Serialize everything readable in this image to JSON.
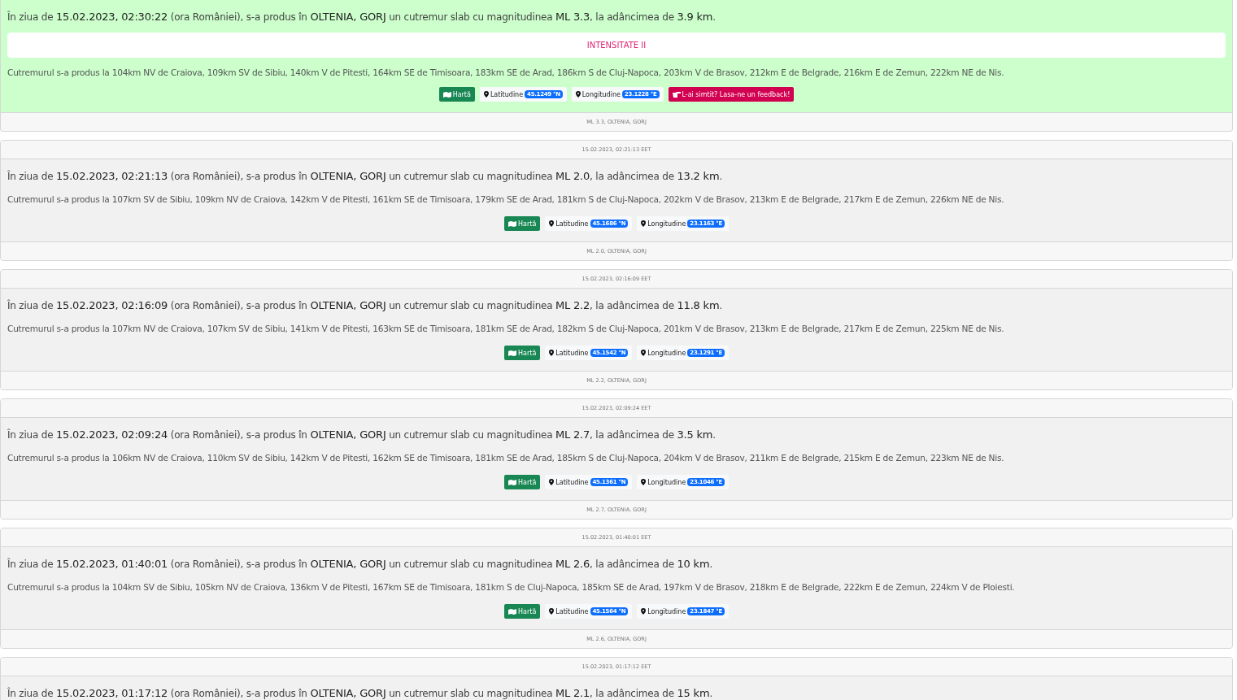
{
  "events": [
    {
      "highlighted": true,
      "sentence": "În ziua de **15.02.2023, 02:30:22** (ora României), s-a produs în **OLTENIA, GORJ** un cutremur slab cu magnitudinea **ML 3.3**, la adâncimea de **3.9 km**.",
      "intensity": "INTENSITATE II",
      "distances": "Cutremurul s-a produs la 104km NV de Craiova, 109km SV de Sibiu, 140km V de Pitesti, 164km SE de Timisoara, 183km SE de Arad, 186km S de Cluj-Napoca, 203km V de Brasov, 212km E de Belgrade, 216km E de Zemun, 222km NE de Nis.",
      "map": "Hartă",
      "lat_label": "Latitudine",
      "lat": "45.1249 °N",
      "lon_label": "Longitudine",
      "lon": "23.1228 °E",
      "feedback": "L-ai simtit? Lasa-ne un feedback!",
      "footer": "ML 3.3, OLTENIA, GORJ"
    },
    {
      "highlighted": false,
      "header": "15.02.2023, 02:21:13 EET",
      "sentence": "În ziua de **15.02.2023, 02:21:13** (ora României), s-a produs în **OLTENIA, GORJ** un cutremur slab cu magnitudinea **ML 2.0**, la adâncimea de **13.2 km**.",
      "distances": "Cutremurul s-a produs la 107km SV de Sibiu, 109km NV de Craiova, 142km V de Pitesti, 161km SE de Timisoara, 179km SE de Arad, 181km S de Cluj-Napoca, 202km V de Brasov, 213km E de Belgrade, 217km E de Zemun, 226km NE de Nis.",
      "map": "Hartă",
      "lat_label": "Latitudine",
      "lat": "45.1686 °N",
      "lon_label": "Longitudine",
      "lon": "23.1163 °E",
      "footer": "ML 2.0, OLTENIA, GORJ"
    },
    {
      "highlighted": false,
      "header": "15.02.2023, 02:16:09 EET",
      "sentence": "În ziua de **15.02.2023, 02:16:09** (ora României), s-a produs în **OLTENIA, GORJ** un cutremur slab cu magnitudinea **ML 2.2**, la adâncimea de **11.8 km**.",
      "distances": "Cutremurul s-a produs la 107km NV de Craiova, 107km SV de Sibiu, 141km V de Pitesti, 163km SE de Timisoara, 181km SE de Arad, 182km S de Cluj-Napoca, 201km V de Brasov, 213km E de Belgrade, 217km E de Zemun, 225km NE de Nis.",
      "map": "Hartă",
      "lat_label": "Latitudine",
      "lat": "45.1542 °N",
      "lon_label": "Longitudine",
      "lon": "23.1291 °E",
      "footer": "ML 2.2, OLTENIA, GORJ"
    },
    {
      "highlighted": false,
      "header": "15.02.2023, 02:09:24 EET",
      "sentence": "În ziua de **15.02.2023, 02:09:24** (ora României), s-a produs în **OLTENIA, GORJ** un cutremur slab cu magnitudinea **ML 2.7**, la adâncimea de **3.5 km**.",
      "distances": "Cutremurul s-a produs la 106km NV de Craiova, 110km SV de Sibiu, 142km V de Pitesti, 162km SE de Timisoara, 181km SE de Arad, 185km S de Cluj-Napoca, 204km V de Brasov, 211km E de Belgrade, 215km E de Zemun, 223km NE de Nis.",
      "map": "Hartă",
      "lat_label": "Latitudine",
      "lat": "45.1361 °N",
      "lon_label": "Longitudine",
      "lon": "23.1046 °E",
      "footer": "ML 2.7, OLTENIA, GORJ"
    },
    {
      "highlighted": false,
      "header": "15.02.2023, 01:40:01 EET",
      "sentence": "În ziua de **15.02.2023, 01:40:01** (ora României), s-a produs în **OLTENIA, GORJ** un cutremur slab cu magnitudinea **ML 2.6**, la adâncimea de **10 km**.",
      "distances": "Cutremurul s-a produs la 104km SV de Sibiu, 105km NV de Craiova, 136km V de Pitesti, 167km SE de Timisoara, 181km S de Cluj-Napoca, 185km SE de Arad, 197km V de Brasov, 218km E de Belgrade, 222km E de Zemun, 224km V de Ploiesti.",
      "map": "Hartă",
      "lat_label": "Latitudine",
      "lat": "45.1564 °N",
      "lon_label": "Longitudine",
      "lon": "23.1847 °E",
      "footer": "ML 2.6, OLTENIA, GORJ"
    },
    {
      "highlighted": false,
      "header": "15.02.2023, 01:17:12 EET",
      "sentence": "În ziua de **15.02.2023, 01:17:12** (ora României), s-a produs în **OLTENIA, GORJ** un cutremur slab cu magnitudinea **ML 2.1**, la adâncimea de **15 km**."
    }
  ]
}
